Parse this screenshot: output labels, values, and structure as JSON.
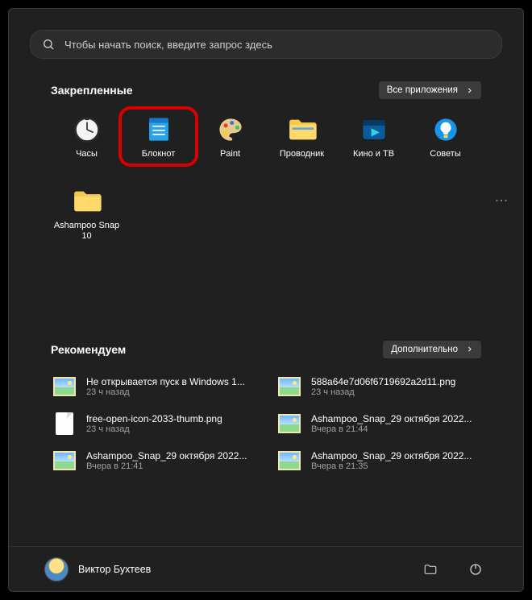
{
  "search": {
    "placeholder": "Чтобы начать поиск, введите запрос здесь"
  },
  "sections": {
    "pinned": {
      "title": "Закрепленные",
      "button": "Все приложения"
    },
    "recommended": {
      "title": "Рекомендуем",
      "button": "Дополнительно"
    }
  },
  "pinned_apps": [
    {
      "name": "Часы",
      "icon": "clock-icon",
      "highlight": false
    },
    {
      "name": "Блокнот",
      "icon": "notepad-icon",
      "highlight": true
    },
    {
      "name": "Paint",
      "icon": "paint-icon",
      "highlight": false
    },
    {
      "name": "Проводник",
      "icon": "explorer-icon",
      "highlight": false
    },
    {
      "name": "Кино и ТВ",
      "icon": "movies-icon",
      "highlight": false
    },
    {
      "name": "Советы",
      "icon": "tips-icon",
      "highlight": false
    },
    {
      "name": "Ashampoo Snap 10",
      "icon": "folder-icon",
      "highlight": false
    }
  ],
  "recommended": [
    {
      "title": "Не открывается пуск в Windows 1...",
      "time": "23 ч назад",
      "thumb": "image"
    },
    {
      "title": "588a64e7d06f6719692a2d11.png",
      "time": "23 ч назад",
      "thumb": "image"
    },
    {
      "title": "free-open-icon-2033-thumb.png",
      "time": "23 ч назад",
      "thumb": "doc"
    },
    {
      "title": "Ashampoo_Snap_29 октября 2022...",
      "time": "Вчера в 21:44",
      "thumb": "image"
    },
    {
      "title": "Ashampoo_Snap_29 октября 2022...",
      "time": "Вчера в 21:41",
      "thumb": "image"
    },
    {
      "title": "Ashampoo_Snap_29 октября 2022...",
      "time": "Вчера в 21:35",
      "thumb": "image"
    }
  ],
  "user": {
    "name": "Виктор Бухтеев"
  }
}
